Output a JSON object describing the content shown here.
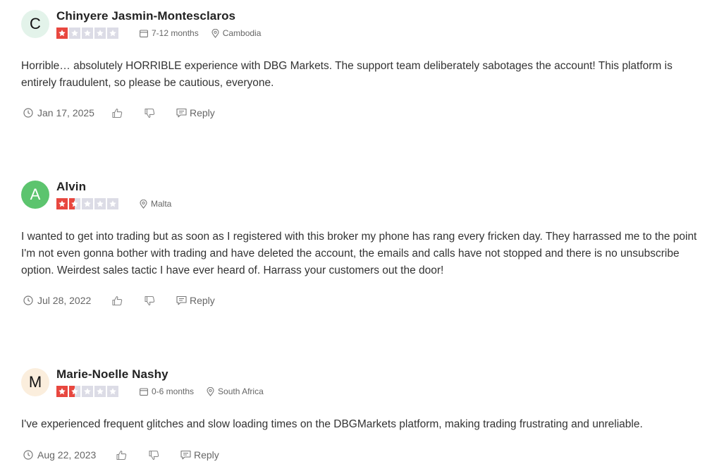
{
  "colors": {
    "star_filled": "#e8473f",
    "star_empty": "#dcdce6"
  },
  "reviews": [
    {
      "initial": "C",
      "avatar_color": "#e3f3ea",
      "name": "Chinyere Jasmin-Montesclaros",
      "rating": 1,
      "duration": "7-12 months",
      "location": "Cambodia",
      "text": "Horrible… absolutely HORRIBLE experience with DBG Markets. The support team deliberately sabotages the account! This platform is entirely fraudulent, so please be cautious, everyone.",
      "date": "Jan 17, 2025",
      "reply_label": "Reply"
    },
    {
      "initial": "A",
      "avatar_color": "#5cc46e",
      "name": "Alvin",
      "rating": 1.5,
      "duration": "",
      "location": "Malta",
      "text": "I wanted to get into trading but as soon as I registered with this broker my phone has rang every fricken day. They harrassed me to the point I'm not even gonna bother with trading and have deleted the account, the emails and calls have not stopped and there is no unsubscribe option. Weirdest sales tactic I have ever heard of. Harrass your customers out the door!",
      "date": "Jul 28, 2022",
      "reply_label": "Reply"
    },
    {
      "initial": "M",
      "avatar_color": "#fbeedd",
      "name": "Marie-Noelle Nashy",
      "rating": 1.5,
      "duration": "0-6 months",
      "location": "South Africa",
      "text": "I've experienced frequent glitches and slow loading times on the DBGMarkets platform, making trading frustrating and unreliable.",
      "date": "Aug 22, 2023",
      "reply_label": "Reply"
    }
  ]
}
